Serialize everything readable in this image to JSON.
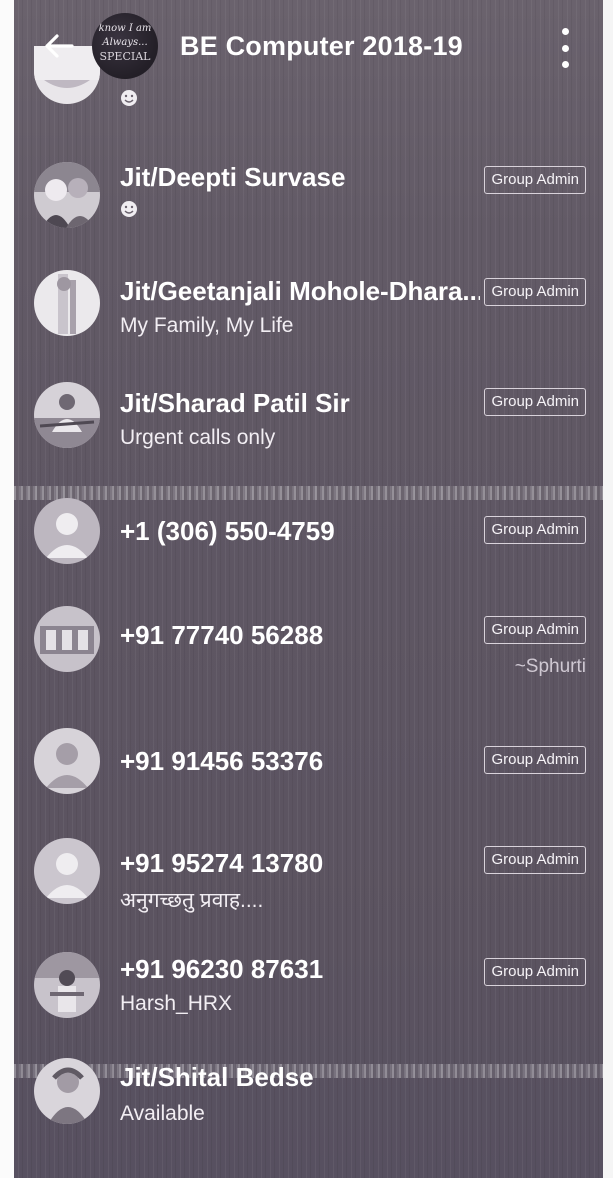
{
  "header": {
    "title": "BE Computer 2018-19",
    "group_avatar_text": [
      "know I am",
      "Always...",
      "SPECIAL"
    ]
  },
  "participants": [
    {
      "name": "",
      "status_icon": "smiley-emoji-icon",
      "badge": ""
    },
    {
      "name": "Jit/Deepti Survase",
      "status_icon": "smiley-emoji-icon",
      "badge": "Group Admin"
    },
    {
      "name": "Jit/Geetanjali Mohole-Dhara...",
      "status": "My Family, My Life",
      "badge": "Group Admin"
    },
    {
      "name": "Jit/Sharad Patil Sir",
      "status": "Urgent calls only",
      "badge": "Group Admin"
    },
    {
      "name": "+1 (306) 550-4759",
      "status": "",
      "badge": "Group Admin"
    },
    {
      "name": "+91 77740 56288",
      "status": "",
      "badge": "Group Admin",
      "alias": "~Sphurti"
    },
    {
      "name": "+91 91456 53376",
      "status": "",
      "badge": "Group Admin"
    },
    {
      "name": "+91 95274 13780",
      "status": "अनुगच्छतु प्रवाह....",
      "badge": "Group Admin"
    },
    {
      "name": "+91 96230 87631",
      "status": "Harsh_HRX",
      "badge": "Group Admin"
    },
    {
      "name": "Jit/Shital Bedse",
      "status": "Available",
      "badge": ""
    }
  ],
  "colors": {
    "background": "#5e5663",
    "text": "#ffffff",
    "badge_border": "#d8d2da"
  }
}
